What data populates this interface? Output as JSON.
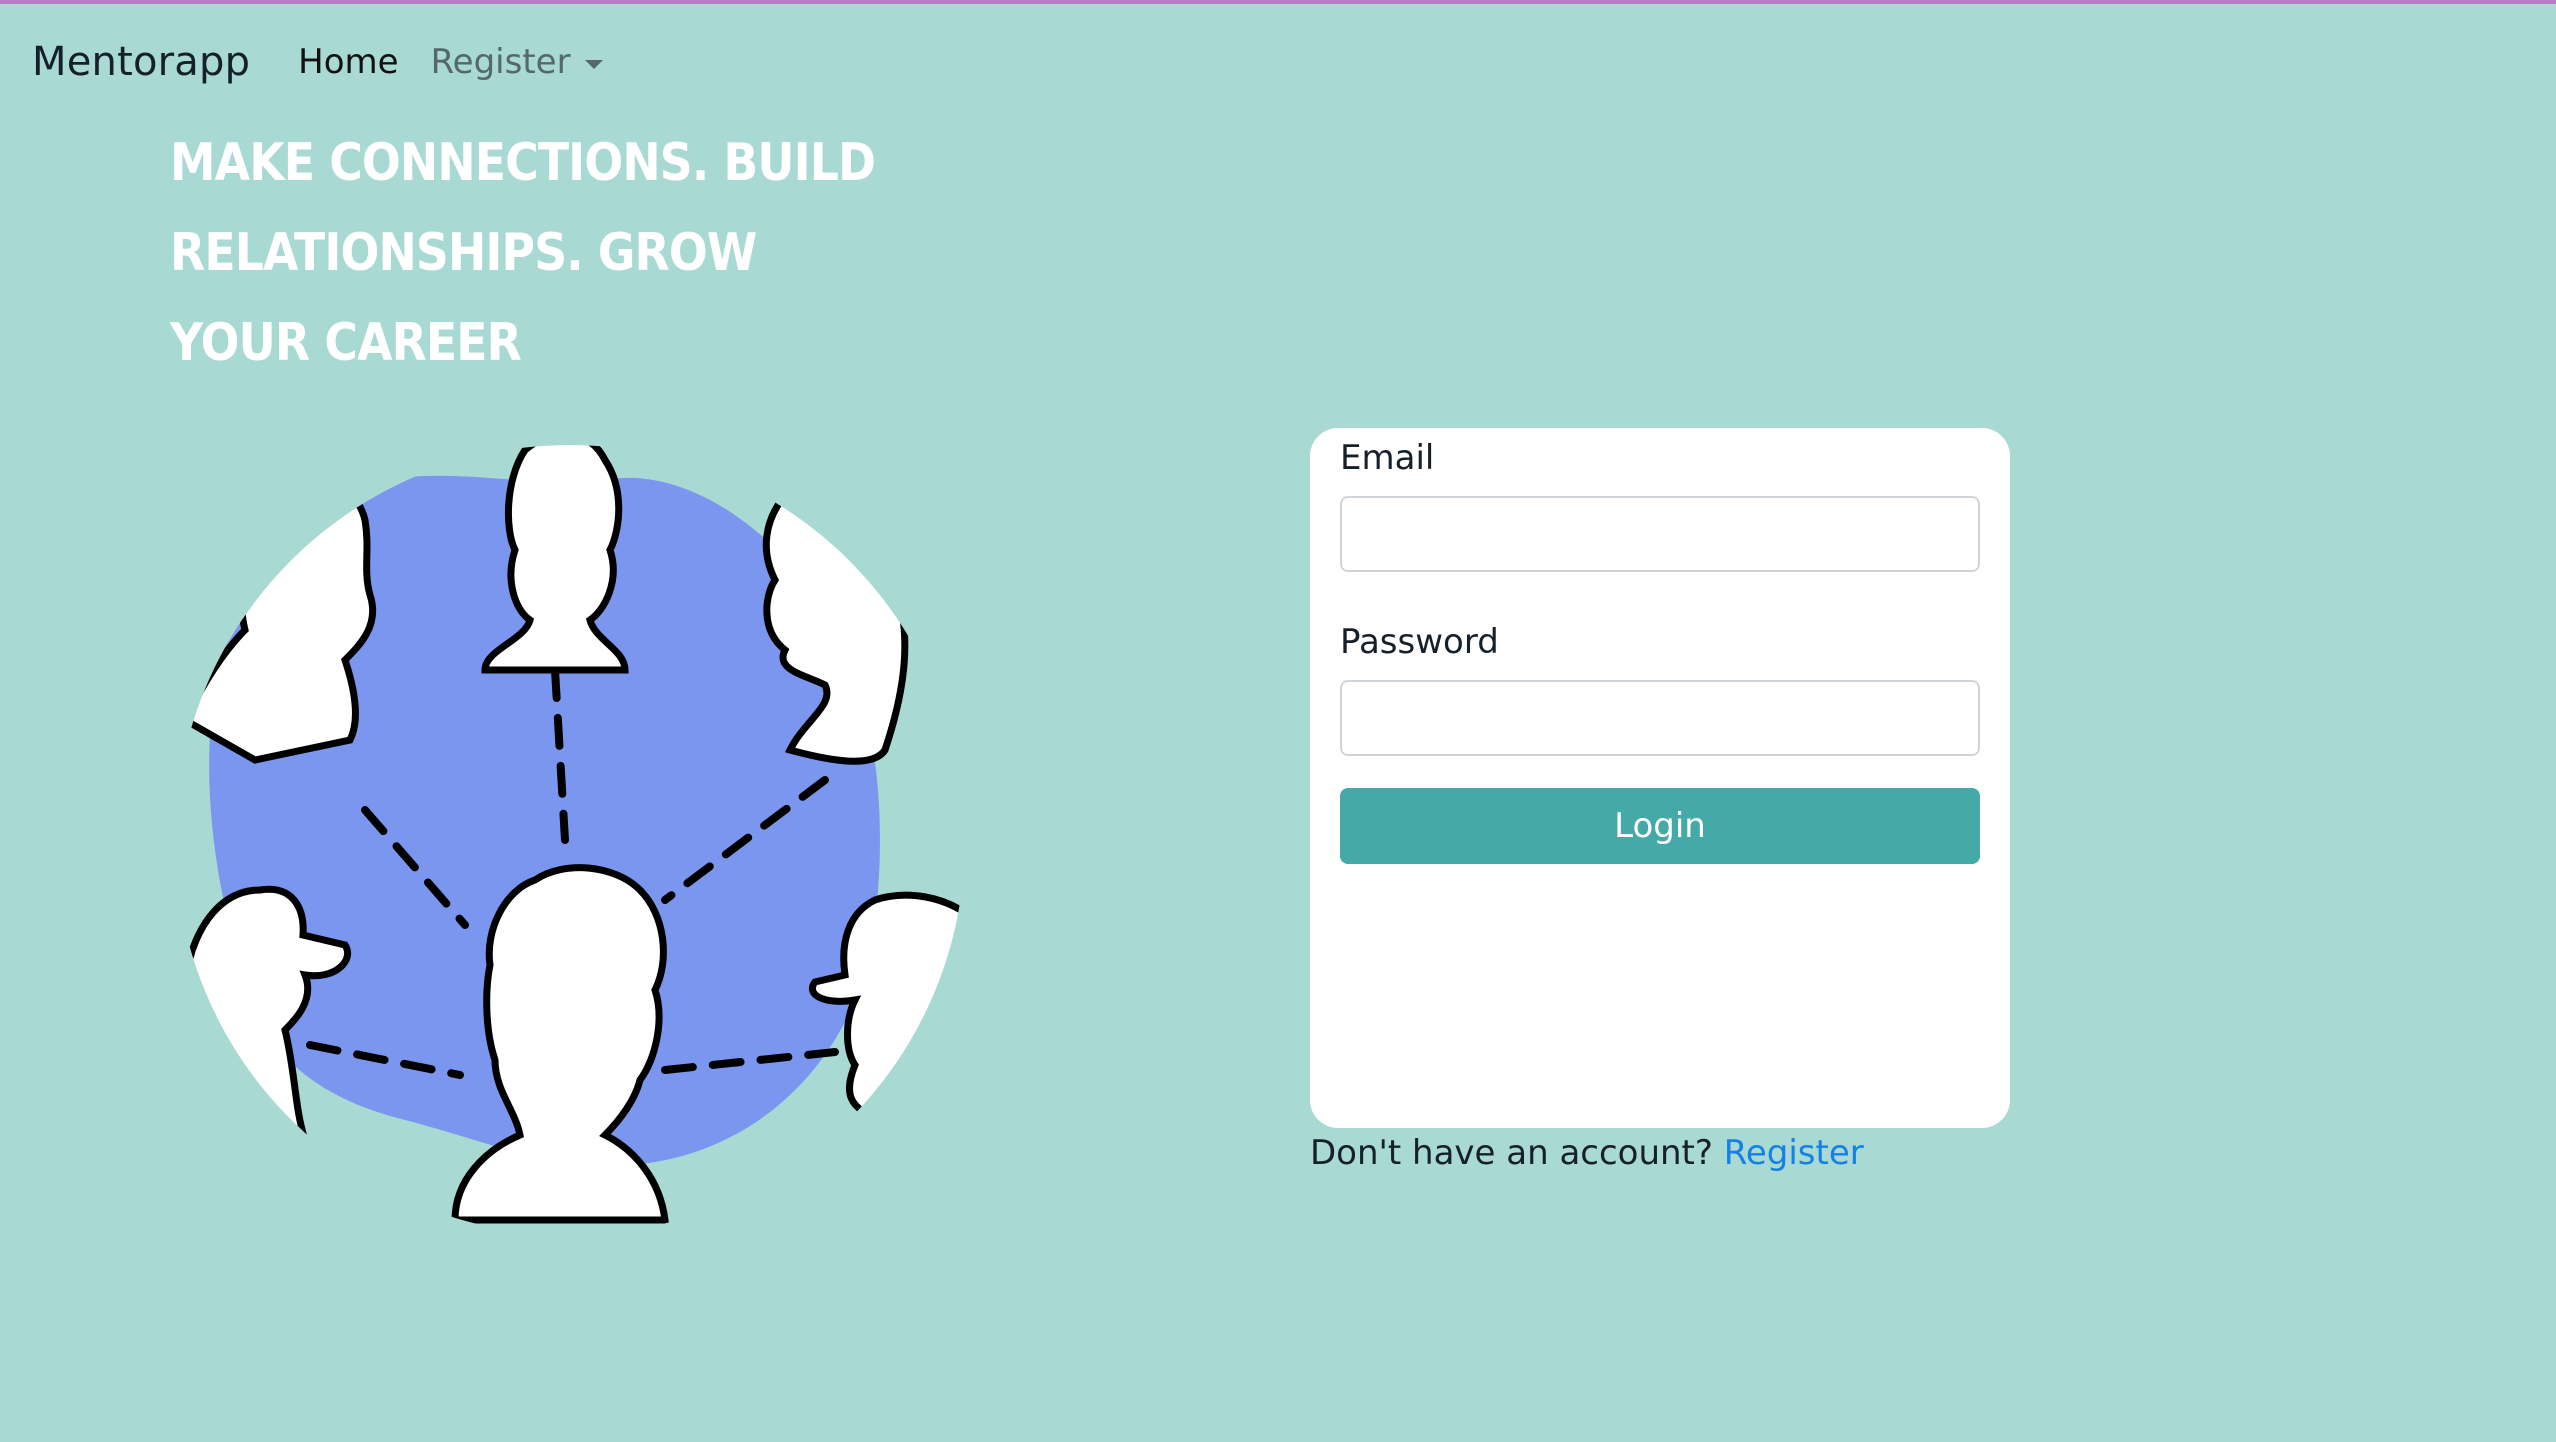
{
  "navbar": {
    "brand": "Mentorapp",
    "home_label": "Home",
    "register_label": "Register",
    "register_dropdown_icon": "caret-down-icon"
  },
  "hero": {
    "heading_line1": "Make connections. Build relationships. Grow",
    "heading_line2": "your career"
  },
  "illustration": {
    "subject": "people-network-illustration",
    "colors": {
      "blob": "#7b96ee",
      "heads": "#ffffff",
      "outline": "#000000"
    }
  },
  "login_form": {
    "email_label": "Email",
    "email_value": "",
    "password_label": "Password",
    "password_value": "",
    "submit_label": "Login"
  },
  "footer_prompt": {
    "text": "Don't have an account?",
    "link_label": "Register"
  },
  "colors": {
    "background": "#a8d9d3",
    "accent_button": "#45a9a7",
    "link": "#1580e6",
    "top_border": "#b77bc7"
  }
}
